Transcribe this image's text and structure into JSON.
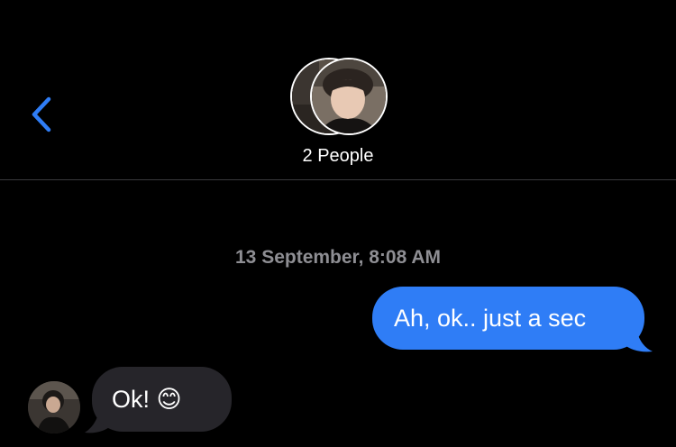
{
  "header": {
    "participants_label": "2 People"
  },
  "conversation": {
    "timestamp": "13 September, 8:08 AM",
    "messages": [
      {
        "direction": "outgoing",
        "text": "Ah, ok.. just a sec"
      },
      {
        "direction": "incoming",
        "text": "Ok! 😊"
      }
    ]
  },
  "colors": {
    "background": "#000000",
    "outgoing_bubble": "#2f7df6",
    "incoming_bubble": "#26252a",
    "accent": "#2f7df6",
    "timestamp": "#8e8e93"
  },
  "icons": {
    "back": "chevron-left-icon"
  }
}
